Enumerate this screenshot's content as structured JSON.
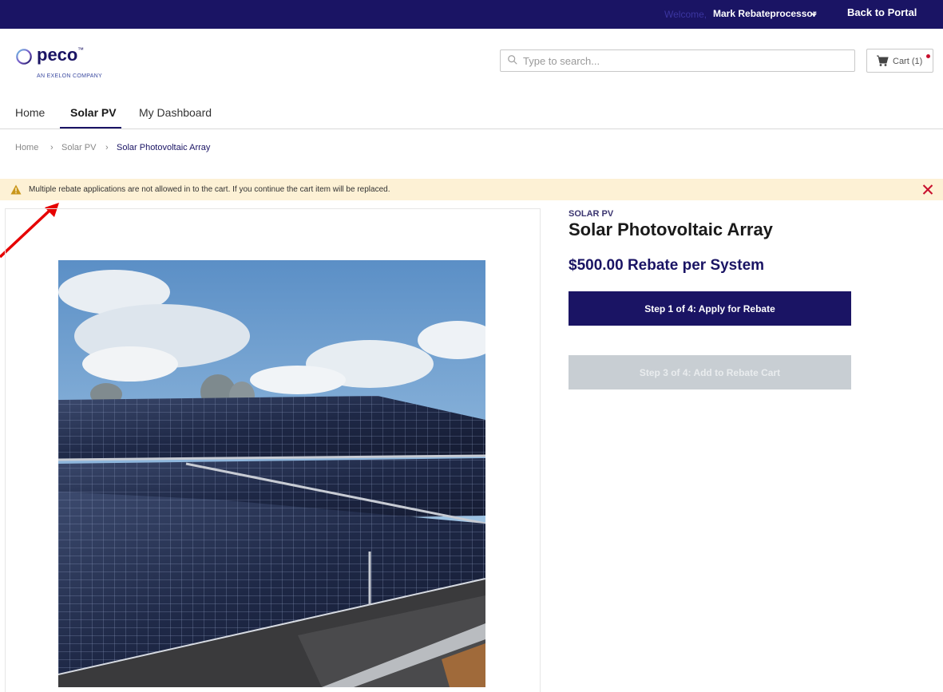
{
  "topbar": {
    "welcome": "Welcome,",
    "user_name": "Mark Rebateprocessor",
    "back_to_portal": "Back to Portal"
  },
  "logo": {
    "name": "peco",
    "trademark": "™",
    "tagline": "AN EXELON COMPANY"
  },
  "search": {
    "placeholder": "Type to search..."
  },
  "cart": {
    "label": "Cart (1)"
  },
  "nav": {
    "items": [
      {
        "label": "Home"
      },
      {
        "label": "Solar PV"
      },
      {
        "label": "My Dashboard"
      }
    ],
    "active": "Solar PV"
  },
  "breadcrumb": {
    "items": [
      "Home",
      "Solar PV",
      "Solar Photovoltaic Array"
    ],
    "separator": "›"
  },
  "alert": {
    "message": "Multiple rebate applications are not allowed in to the cart. If you continue the cart item will be replaced."
  },
  "product": {
    "category": "SOLAR PV",
    "title": "Solar Photovoltaic Array",
    "price": "$500.00 Rebate per System",
    "step1_button": "Step 1 of 4: Apply for Rebate",
    "step3_button": "Step 3 of 4: Add to Rebate Cart"
  },
  "colors": {
    "brand_navy": "#1a1464",
    "alert_bg": "#fdf1d5",
    "alert_icon": "#c9961a",
    "close_red": "#c8102e",
    "annotation_arrow": "#e60000",
    "disabled_button": "#c8ced3"
  }
}
